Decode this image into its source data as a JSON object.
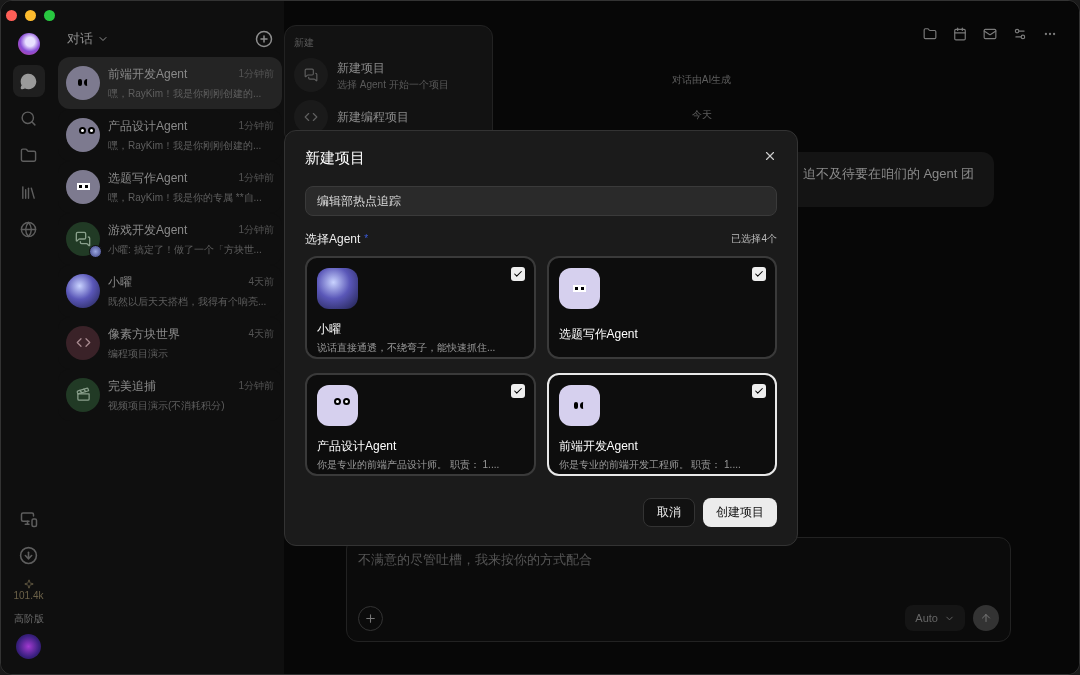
{
  "rail": {
    "nav": [
      {
        "kind": "chats",
        "selected": true
      },
      {
        "kind": "search",
        "selected": false
      },
      {
        "kind": "folders",
        "selected": false
      },
      {
        "kind": "library",
        "selected": false
      },
      {
        "kind": "web",
        "selected": false
      }
    ],
    "credits": "101.4k",
    "plan": "高阶版"
  },
  "conversations": {
    "title": "对话",
    "items": [
      {
        "kind": "bracket-eyes",
        "name": "前端开发Agent",
        "time": "1分钟前",
        "preview": "嘿，RayKim！我是你刚刚创建的...",
        "selected": true
      },
      {
        "kind": "round-eyes",
        "name": "产品设计Agent",
        "time": "1分钟前",
        "preview": "嘿，RayKim！我是你刚刚创建的...",
        "selected": false
      },
      {
        "kind": "dot-eyes",
        "name": "选题写作Agent",
        "time": "1分钟前",
        "preview": "嘿，RayKim！我是你的专属 **自...",
        "selected": false
      },
      {
        "kind": "chat-group",
        "name": "游戏开发Agent",
        "time": "1分钟前",
        "preview": "小曜: 搞定了！做了一个「方块世...",
        "selected": false
      },
      {
        "kind": "photo",
        "name": "小曜",
        "time": "4天前",
        "preview": "既然以后天天搭档，我得有个响亮...",
        "selected": false
      },
      {
        "kind": "code",
        "name": "像素方块世界",
        "time": "4天前",
        "preview": "编程项目演示",
        "selected": false
      },
      {
        "kind": "video",
        "name": "完美追捕",
        "time": "1分钟前",
        "preview": "视频项目演示(不消耗积分)",
        "selected": false
      }
    ]
  },
  "new_menu": {
    "title": "新建",
    "items": [
      {
        "kind": "project",
        "label": "新建项目",
        "description": "选择 Agent 开始一个项目"
      },
      {
        "kind": "code",
        "label": "新建编程项目"
      }
    ]
  },
  "chat": {
    "notice": "对话由AI生成",
    "date": "今天",
    "message": "迫不及待要在咱们的 Agent 团",
    "input": {
      "placeholder": "不满意的尽管吐槽，我来按你的方式配合",
      "model": "Auto"
    }
  },
  "dialog": {
    "title": "新建项目",
    "name_value": "编辑部热点追踪",
    "agents_label": "选择Agent",
    "required_mark": "*",
    "selected_count": "已选择4个",
    "agents": [
      {
        "kind": "photo",
        "name": "小曜",
        "description": "说话直接通透，不绕弯子，能快速抓住...",
        "checked": true,
        "selected": false
      },
      {
        "kind": "dot-eyes",
        "name": "选题写作Agent",
        "checked": true,
        "selected": false
      },
      {
        "kind": "round-eyes",
        "name": "产品设计Agent",
        "description": "你是专业的前端产品设计师。 职责： 1....",
        "checked": true,
        "selected": false
      },
      {
        "kind": "bracket-eyes",
        "name": "前端开发Agent",
        "description": "你是专业的前端开发工程师。 职责： 1....",
        "checked": true,
        "selected": true
      }
    ],
    "cancel": "取消",
    "create": "创建项目"
  }
}
